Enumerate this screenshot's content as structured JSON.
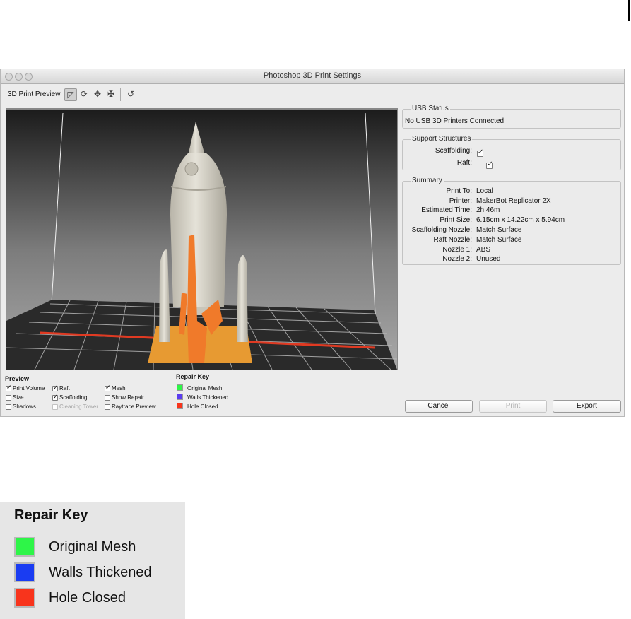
{
  "window": {
    "title": "Photoshop 3D Print Settings"
  },
  "toolbar": {
    "label": "3D Print Preview",
    "buttons": [
      "view-icon",
      "rotate-icon",
      "pan-icon",
      "slide-icon",
      "reset-icon"
    ]
  },
  "usb_status": {
    "title": "USB Status",
    "text": "No USB 3D Printers Connected."
  },
  "support": {
    "title": "Support Structures",
    "scaffolding_label": "Scaffolding:",
    "raft_label": "Raft:",
    "scaffolding_checked": true,
    "raft_checked": true
  },
  "summary": {
    "title": "Summary",
    "rows": [
      {
        "label": "Print To:",
        "value": "Local"
      },
      {
        "label": "Printer:",
        "value": "MakerBot Replicator 2X"
      },
      {
        "label": "Estimated Time:",
        "value": "2h 46m"
      },
      {
        "label": "Print Size:",
        "value": "6.15cm x 14.22cm x 5.94cm"
      },
      {
        "label": "Scaffolding Nozzle:",
        "value": "Match Surface"
      },
      {
        "label": "Raft Nozzle:",
        "value": "Match Surface"
      },
      {
        "label": "Nozzle 1:",
        "value": "ABS"
      },
      {
        "label": "Nozzle 2:",
        "value": "Unused"
      }
    ]
  },
  "preview": {
    "title": "Preview",
    "options": [
      {
        "label": "Print Volume",
        "checked": true,
        "enabled": true
      },
      {
        "label": "Raft",
        "checked": true,
        "enabled": true
      },
      {
        "label": "Mesh",
        "checked": true,
        "enabled": true
      },
      {
        "label": "Size",
        "checked": false,
        "enabled": true
      },
      {
        "label": "Scaffolding",
        "checked": true,
        "enabled": true
      },
      {
        "label": "Show Repair",
        "checked": false,
        "enabled": true
      },
      {
        "label": "Shadows",
        "checked": false,
        "enabled": true
      },
      {
        "label": "Cleaning Tower",
        "checked": false,
        "enabled": false
      },
      {
        "label": "Raytrace Preview",
        "checked": false,
        "enabled": true
      }
    ]
  },
  "repair_key": {
    "title": "Repair Key",
    "items": [
      {
        "label": "Original Mesh",
        "color": "#2ef548"
      },
      {
        "label": "Walls Thickened",
        "color": "#1a3cf2"
      },
      {
        "label": "Hole Closed",
        "color": "#f8341c"
      }
    ]
  },
  "buttons": {
    "cancel": "Cancel",
    "print": "Print",
    "export": "Export"
  },
  "colors": {
    "model": "#d8d4c8",
    "scaffold": "#f07a2a",
    "raft": "#e79a32",
    "grid_line": "#e03a22"
  }
}
